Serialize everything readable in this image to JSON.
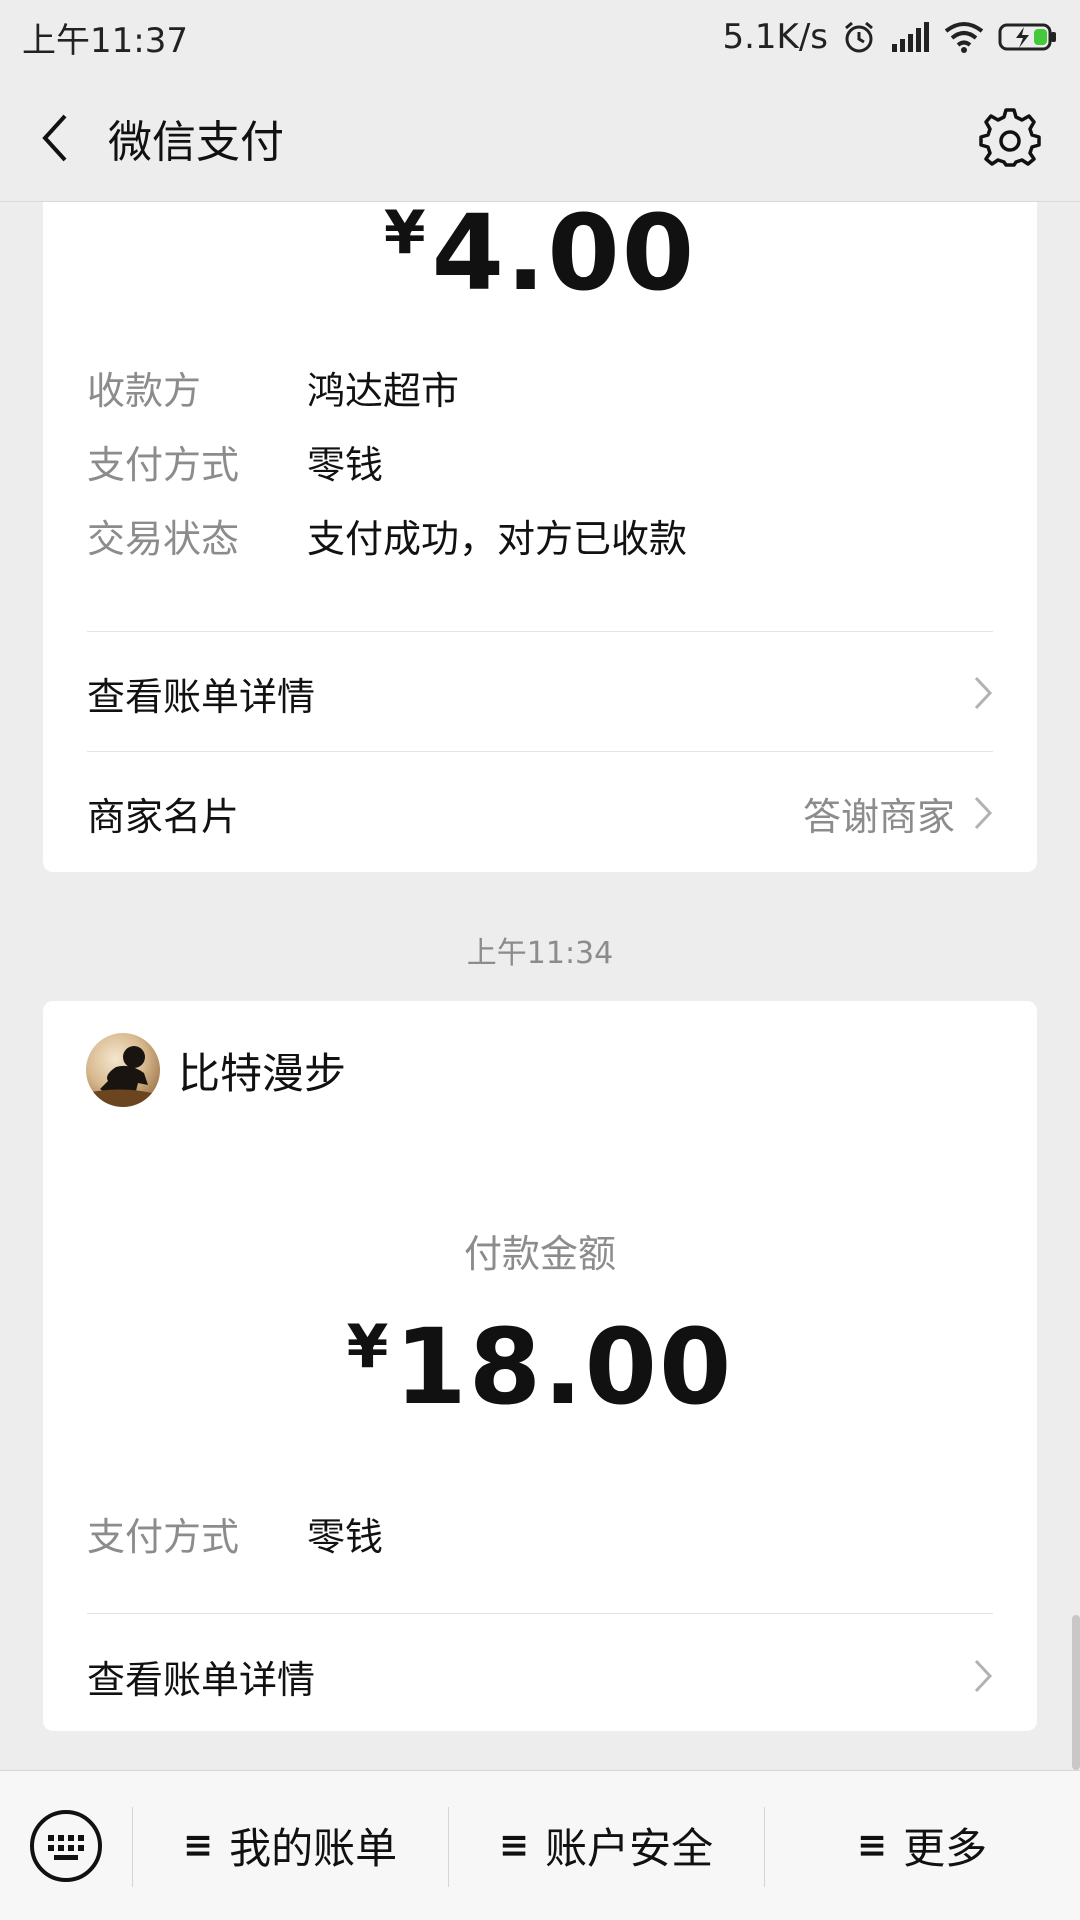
{
  "status_bar": {
    "time": "上午11:37",
    "net_speed": "5.1K/s",
    "icons": [
      "alarm-icon",
      "signal-icon",
      "wifi-icon",
      "battery-icon"
    ]
  },
  "header": {
    "title": "微信支付",
    "back_icon": "chevron-left-icon",
    "settings_icon": "gear-icon"
  },
  "card1": {
    "currency": "¥",
    "amount": "4.00",
    "details": [
      {
        "label": "收款方",
        "value": "鸿达超市"
      },
      {
        "label": "支付方式",
        "value": "零钱"
      },
      {
        "label": "交易状态",
        "value": "支付成功，对方已收款"
      }
    ],
    "view_bill": "查看账单详情",
    "merchant_card": "商家名片",
    "thank_merchant": "答谢商家"
  },
  "time_separator": "上午11:34",
  "card2": {
    "merchant_name": "比特漫步",
    "amount_label": "付款金额",
    "currency": "¥",
    "amount": "18.00",
    "details": [
      {
        "label": "支付方式",
        "value": "零钱"
      }
    ],
    "view_bill": "查看账单详情"
  },
  "bottom_menu": {
    "keyboard_icon": "keyboard-icon",
    "items": [
      "我的账单",
      "账户安全",
      "更多"
    ],
    "menu_glyph": "≡"
  },
  "colors": {
    "background": "#ededed",
    "card": "#ffffff",
    "secondary_text": "#8c8c8c",
    "battery_green": "#44c93b"
  }
}
